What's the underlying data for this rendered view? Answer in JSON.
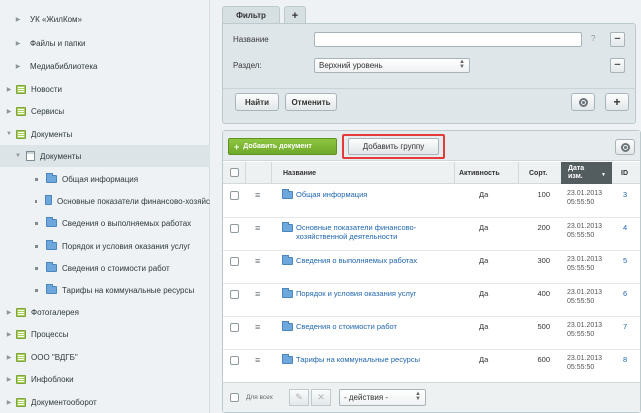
{
  "sidebar": {
    "items": [
      {
        "label": "УК «ЖилКом»",
        "level": 1,
        "type": "bullet"
      },
      {
        "label": "Файлы и папки",
        "level": 1,
        "type": "bullet"
      },
      {
        "label": "Медиабиблиотека",
        "level": 1,
        "type": "bullet"
      },
      {
        "label": "Новости",
        "level": 0,
        "type": "section"
      },
      {
        "label": "Сервисы",
        "level": 0,
        "type": "section"
      },
      {
        "label": "Документы",
        "level": 0,
        "type": "section",
        "expanded": true
      },
      {
        "label": "Документы",
        "level": 1,
        "type": "doc",
        "active": true
      },
      {
        "label": "Общая информация",
        "level": 2,
        "type": "folder"
      },
      {
        "label": "Основные показатели финансово-хозяйс",
        "level": 2,
        "type": "folder"
      },
      {
        "label": "Сведения о выполняемых работах",
        "level": 2,
        "type": "folder"
      },
      {
        "label": "Порядок и условия оказания услуг",
        "level": 2,
        "type": "folder"
      },
      {
        "label": "Сведения о стоимости работ",
        "level": 2,
        "type": "folder"
      },
      {
        "label": "Тарифы на коммунальные ресурсы",
        "level": 2,
        "type": "folder"
      },
      {
        "label": "Фотогалерея",
        "level": 0,
        "type": "section"
      },
      {
        "label": "Процессы",
        "level": 0,
        "type": "section"
      },
      {
        "label": "ООО \"ВДГБ\"",
        "level": 0,
        "type": "section"
      },
      {
        "label": "Инфоблоки",
        "level": 0,
        "type": "section"
      },
      {
        "label": "Документооборот",
        "level": 0,
        "type": "section"
      }
    ]
  },
  "filter": {
    "tab_label": "Фильтр",
    "add_tab": "+",
    "name_label": "Название",
    "name_value": "",
    "help": "?",
    "section_label": "Раздел:",
    "section_value": "Верхний уровень",
    "find_button": "Найти",
    "cancel_button": "Отменить",
    "remove_sign": "−",
    "add_sign": "+"
  },
  "toolbar": {
    "add_document": "Добавить документ",
    "add_group": "Добавить группу",
    "highlight_color": "#e43a3a"
  },
  "table": {
    "headers": {
      "name": "Название",
      "activity": "Активность",
      "sort": "Сорт.",
      "date": "Дата изм.",
      "id": "ID"
    },
    "rows": [
      {
        "name": "Общая информация",
        "active": "Да",
        "sort": "100",
        "date": "23.01.2013",
        "time": "05:55:50",
        "id": "3"
      },
      {
        "name": "Основные показатели финансово-хозяйственной деятельности",
        "active": "Да",
        "sort": "200",
        "date": "23.01.2013",
        "time": "05:55:50",
        "id": "4"
      },
      {
        "name": "Сведения о выполняемых работах",
        "active": "Да",
        "sort": "300",
        "date": "23.01.2013",
        "time": "05:55:50",
        "id": "5"
      },
      {
        "name": "Порядок и условия оказания услуг",
        "active": "Да",
        "sort": "400",
        "date": "23.01.2013",
        "time": "05:55:50",
        "id": "6"
      },
      {
        "name": "Сведения о стоимости работ",
        "active": "Да",
        "sort": "500",
        "date": "23.01.2013",
        "time": "05:55:50",
        "id": "7"
      },
      {
        "name": "Тарифы на коммунальные ресурсы",
        "active": "Да",
        "sort": "600",
        "date": "23.01.2013",
        "time": "05:55:50",
        "id": "8"
      }
    ]
  },
  "footer": {
    "for_all": "Для всех",
    "actions": "- действия -"
  }
}
